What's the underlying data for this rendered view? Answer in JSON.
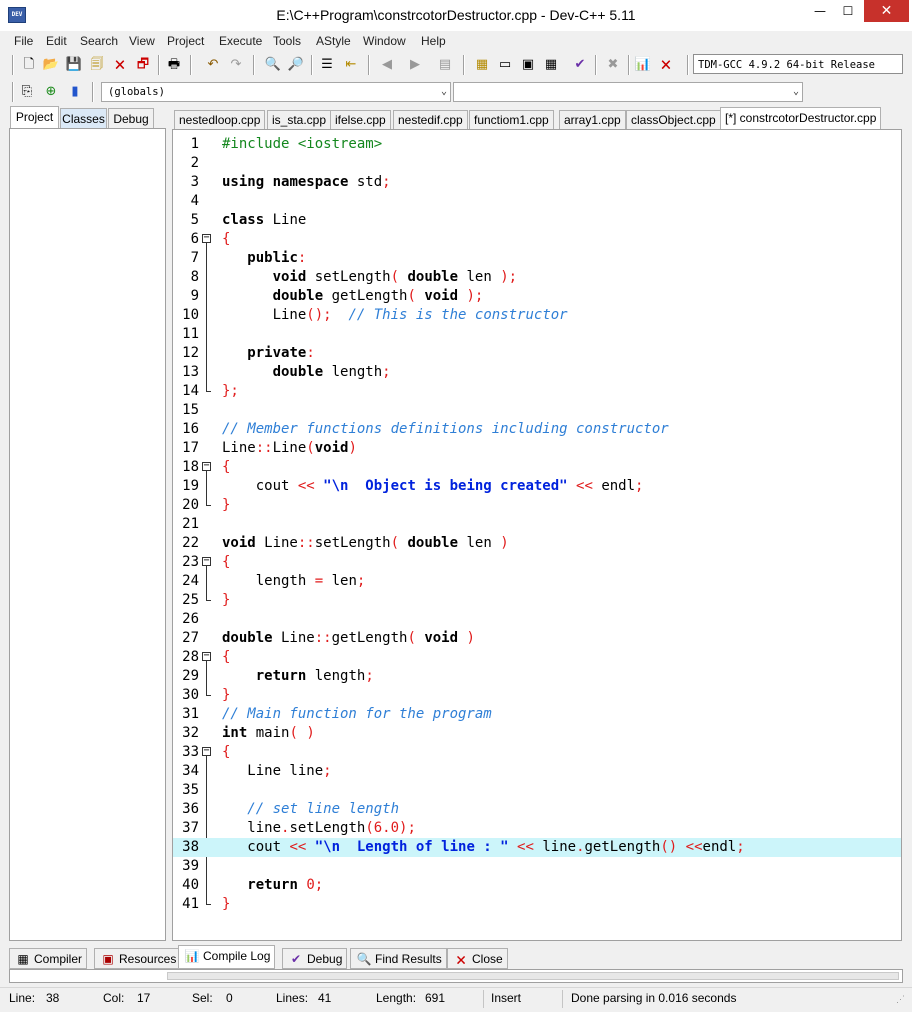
{
  "window": {
    "title": "E:\\C++Program\\constrcotorDestructor.cpp - Dev-C++ 5.11",
    "min": "—",
    "max": "☐",
    "close": "✕",
    "app_icon": "DEV"
  },
  "menu": [
    "File",
    "Edit",
    "Search",
    "View",
    "Project",
    "Execute",
    "Tools",
    "AStyle",
    "Window",
    "Help"
  ],
  "toolbar": {
    "compiler": "TDM-GCC 4.9.2 64-bit Release",
    "scope_combo": "(globals)",
    "member_combo": ""
  },
  "left_tabs": [
    "Project",
    "Classes",
    "Debug"
  ],
  "editor_tabs": [
    "nestedloop.cpp",
    "is_sta.cpp",
    "ifelse.cpp",
    "nestedif.cpp",
    "functiom1.cpp",
    "array1.cpp",
    "classObject.cpp",
    "[*] constrcotorDestructor.cpp"
  ],
  "code": [
    [
      [
        "pre",
        "#include <iostream>"
      ]
    ],
    [],
    [
      [
        "kw",
        "using"
      ],
      [
        "ident",
        " "
      ],
      [
        "kw",
        "namespace"
      ],
      [
        "ident",
        " std"
      ],
      [
        "sym",
        ";"
      ]
    ],
    [],
    [
      [
        "kw",
        "class"
      ],
      [
        "ident",
        " Line"
      ]
    ],
    [
      [
        "sym",
        "{"
      ]
    ],
    [
      [
        "ident",
        "   "
      ],
      [
        "kw",
        "public"
      ],
      [
        "sym",
        ":"
      ]
    ],
    [
      [
        "ident",
        "      "
      ],
      [
        "kw",
        "void"
      ],
      [
        "ident",
        " setLength"
      ],
      [
        "sym",
        "("
      ],
      [
        "ident",
        " "
      ],
      [
        "kw",
        "double"
      ],
      [
        "ident",
        " len "
      ],
      [
        "sym",
        ");"
      ]
    ],
    [
      [
        "ident",
        "      "
      ],
      [
        "kw",
        "double"
      ],
      [
        "ident",
        " getLength"
      ],
      [
        "sym",
        "("
      ],
      [
        "ident",
        " "
      ],
      [
        "kw",
        "void"
      ],
      [
        "ident",
        " "
      ],
      [
        "sym",
        ");"
      ]
    ],
    [
      [
        "ident",
        "      Line"
      ],
      [
        "sym",
        "();"
      ],
      [
        "ident",
        "  "
      ],
      [
        "cmt",
        "// This is the constructor"
      ]
    ],
    [],
    [
      [
        "ident",
        "   "
      ],
      [
        "kw",
        "private"
      ],
      [
        "sym",
        ":"
      ]
    ],
    [
      [
        "ident",
        "      "
      ],
      [
        "kw",
        "double"
      ],
      [
        "ident",
        " length"
      ],
      [
        "sym",
        ";"
      ]
    ],
    [
      [
        "sym",
        "};"
      ]
    ],
    [],
    [
      [
        "cmt",
        "// Member functions definitions including constructor"
      ]
    ],
    [
      [
        "ident",
        "Line"
      ],
      [
        "sym",
        "::"
      ],
      [
        "ident",
        "Line"
      ],
      [
        "sym",
        "("
      ],
      [
        "kw",
        "void"
      ],
      [
        "sym",
        ")"
      ]
    ],
    [
      [
        "sym",
        "{"
      ]
    ],
    [
      [
        "ident",
        "    cout "
      ],
      [
        "sym",
        "<<"
      ],
      [
        "ident",
        " "
      ],
      [
        "str",
        "\"\\n  Object is being created\""
      ],
      [
        "ident",
        " "
      ],
      [
        "sym",
        "<<"
      ],
      [
        "ident",
        " endl"
      ],
      [
        "sym",
        ";"
      ]
    ],
    [
      [
        "sym",
        "}"
      ]
    ],
    [],
    [
      [
        "kw",
        "void"
      ],
      [
        "ident",
        " Line"
      ],
      [
        "sym",
        "::"
      ],
      [
        "ident",
        "setLength"
      ],
      [
        "sym",
        "("
      ],
      [
        "ident",
        " "
      ],
      [
        "kw",
        "double"
      ],
      [
        "ident",
        " len "
      ],
      [
        "sym",
        ")"
      ]
    ],
    [
      [
        "sym",
        "{"
      ]
    ],
    [
      [
        "ident",
        "    length "
      ],
      [
        "sym",
        "="
      ],
      [
        "ident",
        " len"
      ],
      [
        "sym",
        ";"
      ]
    ],
    [
      [
        "sym",
        "}"
      ]
    ],
    [],
    [
      [
        "kw",
        "double"
      ],
      [
        "ident",
        " Line"
      ],
      [
        "sym",
        "::"
      ],
      [
        "ident",
        "getLength"
      ],
      [
        "sym",
        "("
      ],
      [
        "ident",
        " "
      ],
      [
        "kw",
        "void"
      ],
      [
        "ident",
        " "
      ],
      [
        "sym",
        ")"
      ]
    ],
    [
      [
        "sym",
        "{"
      ]
    ],
    [
      [
        "ident",
        "    "
      ],
      [
        "kw",
        "return"
      ],
      [
        "ident",
        " length"
      ],
      [
        "sym",
        ";"
      ]
    ],
    [
      [
        "sym",
        "}"
      ]
    ],
    [
      [
        "cmt",
        "// Main function for the program"
      ]
    ],
    [
      [
        "kw",
        "int"
      ],
      [
        "ident",
        " main"
      ],
      [
        "sym",
        "("
      ],
      [
        "ident",
        " "
      ],
      [
        "sym",
        ")"
      ]
    ],
    [
      [
        "sym",
        "{"
      ]
    ],
    [
      [
        "ident",
        "   Line line"
      ],
      [
        "sym",
        ";"
      ]
    ],
    [],
    [
      [
        "ident",
        "   "
      ],
      [
        "cmt",
        "// set line length"
      ]
    ],
    [
      [
        "ident",
        "   line"
      ],
      [
        "sym",
        "."
      ],
      [
        "ident",
        "setLength"
      ],
      [
        "sym",
        "("
      ],
      [
        "num",
        "6.0"
      ],
      [
        "sym",
        ");"
      ]
    ],
    [
      [
        "ident",
        "   cout "
      ],
      [
        "sym",
        "<<"
      ],
      [
        "ident",
        " "
      ],
      [
        "str",
        "\"\\n  Length of line : \""
      ],
      [
        "ident",
        " "
      ],
      [
        "sym",
        "<<"
      ],
      [
        "ident",
        " line"
      ],
      [
        "sym",
        "."
      ],
      [
        "ident",
        "getLength"
      ],
      [
        "sym",
        "()"
      ],
      [
        "ident",
        " "
      ],
      [
        "sym",
        "<<"
      ],
      [
        "ident",
        "endl"
      ],
      [
        "sym",
        ";"
      ]
    ],
    [],
    [
      [
        "ident",
        "   "
      ],
      [
        "kw",
        "return"
      ],
      [
        "ident",
        " "
      ],
      [
        "num",
        "0"
      ],
      [
        "sym",
        ";"
      ]
    ],
    [
      [
        "sym",
        "}"
      ]
    ]
  ],
  "fold_lines": [
    6,
    18,
    23,
    28,
    33
  ],
  "current_line": 38,
  "bottom_tabs": [
    {
      "label": "Compiler",
      "icon": "compiler-icon"
    },
    {
      "label": "Resources",
      "icon": "resources-icon"
    },
    {
      "label": "Compile Log",
      "icon": "compile-log-icon"
    },
    {
      "label": "Debug",
      "icon": "debug-icon"
    },
    {
      "label": "Find Results",
      "icon": "find-results-icon"
    },
    {
      "label": "Close",
      "icon": "close-icon"
    }
  ],
  "status": {
    "line_label": "Line:",
    "line": "38",
    "col_label": "Col:",
    "col": "17",
    "sel_label": "Sel:",
    "sel": "0",
    "lines_label": "Lines:",
    "lines": "41",
    "length_label": "Length:",
    "length": "691",
    "mode": "Insert",
    "message": "Done parsing in 0.016 seconds"
  },
  "colors": {
    "keyword": "#000000",
    "symbol": "#e01b1b",
    "string": "#0022dd",
    "comment": "#2f7fd6",
    "preprocessor": "#14871e",
    "current_line": "#ccf5fa"
  }
}
